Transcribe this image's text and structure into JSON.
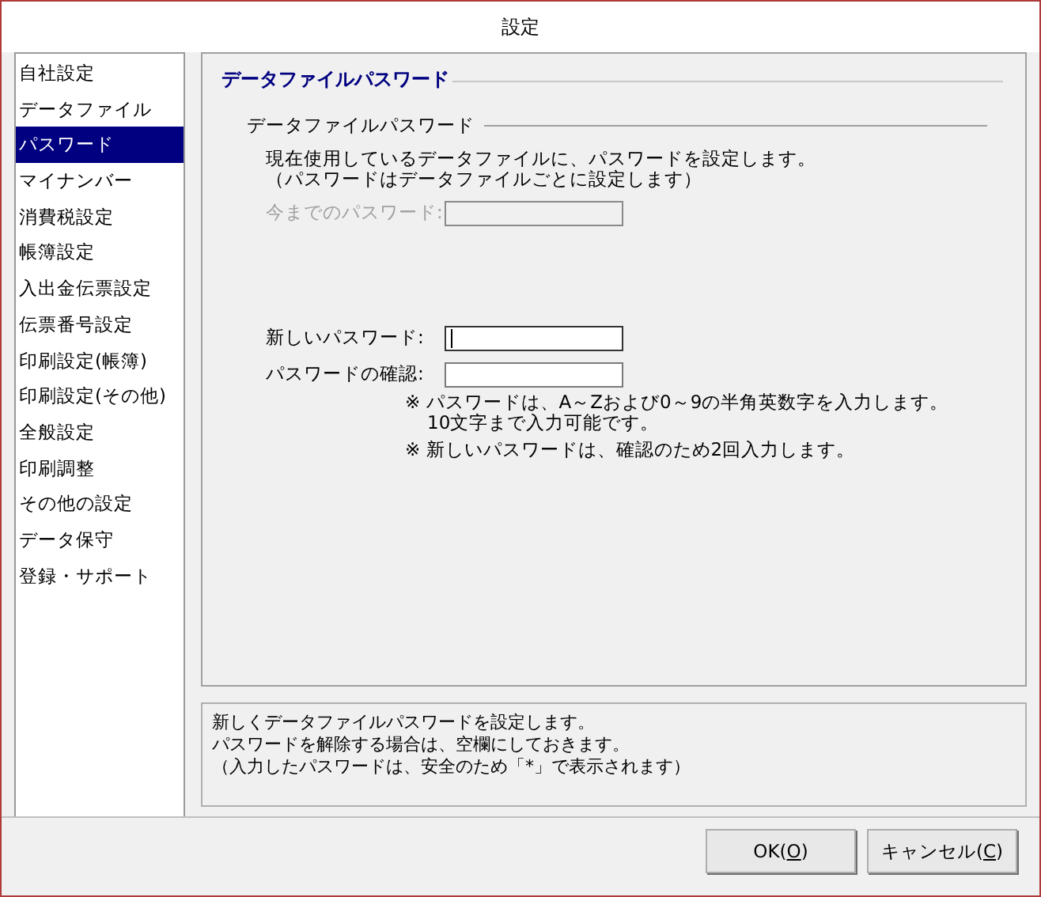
{
  "window": {
    "title": "設定"
  },
  "sidebar": {
    "items": [
      {
        "label": "自社設定",
        "selected": false
      },
      {
        "label": "データファイル",
        "selected": false
      },
      {
        "label": "パスワード",
        "selected": true
      },
      {
        "label": "マイナンバー",
        "selected": false
      },
      {
        "label": "消費税設定",
        "selected": false
      },
      {
        "label": "帳簿設定",
        "selected": false
      },
      {
        "label": "入出金伝票設定",
        "selected": false
      },
      {
        "label": "伝票番号設定",
        "selected": false
      },
      {
        "label": "印刷設定(帳簿)",
        "selected": false
      },
      {
        "label": "印刷設定(その他)",
        "selected": false
      },
      {
        "label": "全般設定",
        "selected": false
      },
      {
        "label": "印刷調整",
        "selected": false
      },
      {
        "label": "その他の設定",
        "selected": false
      },
      {
        "label": "データ保守",
        "selected": false
      },
      {
        "label": "登録・サポート",
        "selected": false
      }
    ]
  },
  "panel": {
    "title": "データファイルパスワード",
    "section": {
      "title": "データファイルパスワード",
      "description": [
        "現在使用しているデータファイルに、パスワードを設定します。",
        "（パスワードはデータファイルごとに設定します）"
      ],
      "old_field": {
        "label": "今までのパスワード:",
        "disabled": true
      },
      "fields": [
        {
          "label": "新しいパスワード:",
          "focused": true,
          "disabled": false
        },
        {
          "label": "パスワードの確認:",
          "focused": false,
          "disabled": false
        }
      ],
      "notes": [
        {
          "lines": [
            "※ パスワードは、A～Zおよび0～9の半角英数字を入力します。",
            "10文字まで入力可能です。"
          ]
        },
        {
          "lines": [
            "※ 新しいパスワードは、確認のため2回入力します。"
          ]
        }
      ]
    }
  },
  "info": [
    "新しくデータファイルパスワードを設定します。",
    "パスワードを解除する場合は、空欄にしておきます。",
    "（入力したパスワードは、安全のため「*」で表示されます）"
  ],
  "buttons": [
    {
      "before": "OK(",
      "key": "O",
      "after": ")"
    },
    {
      "before": "キャンセル(",
      "key": "C",
      "after": ")"
    }
  ]
}
